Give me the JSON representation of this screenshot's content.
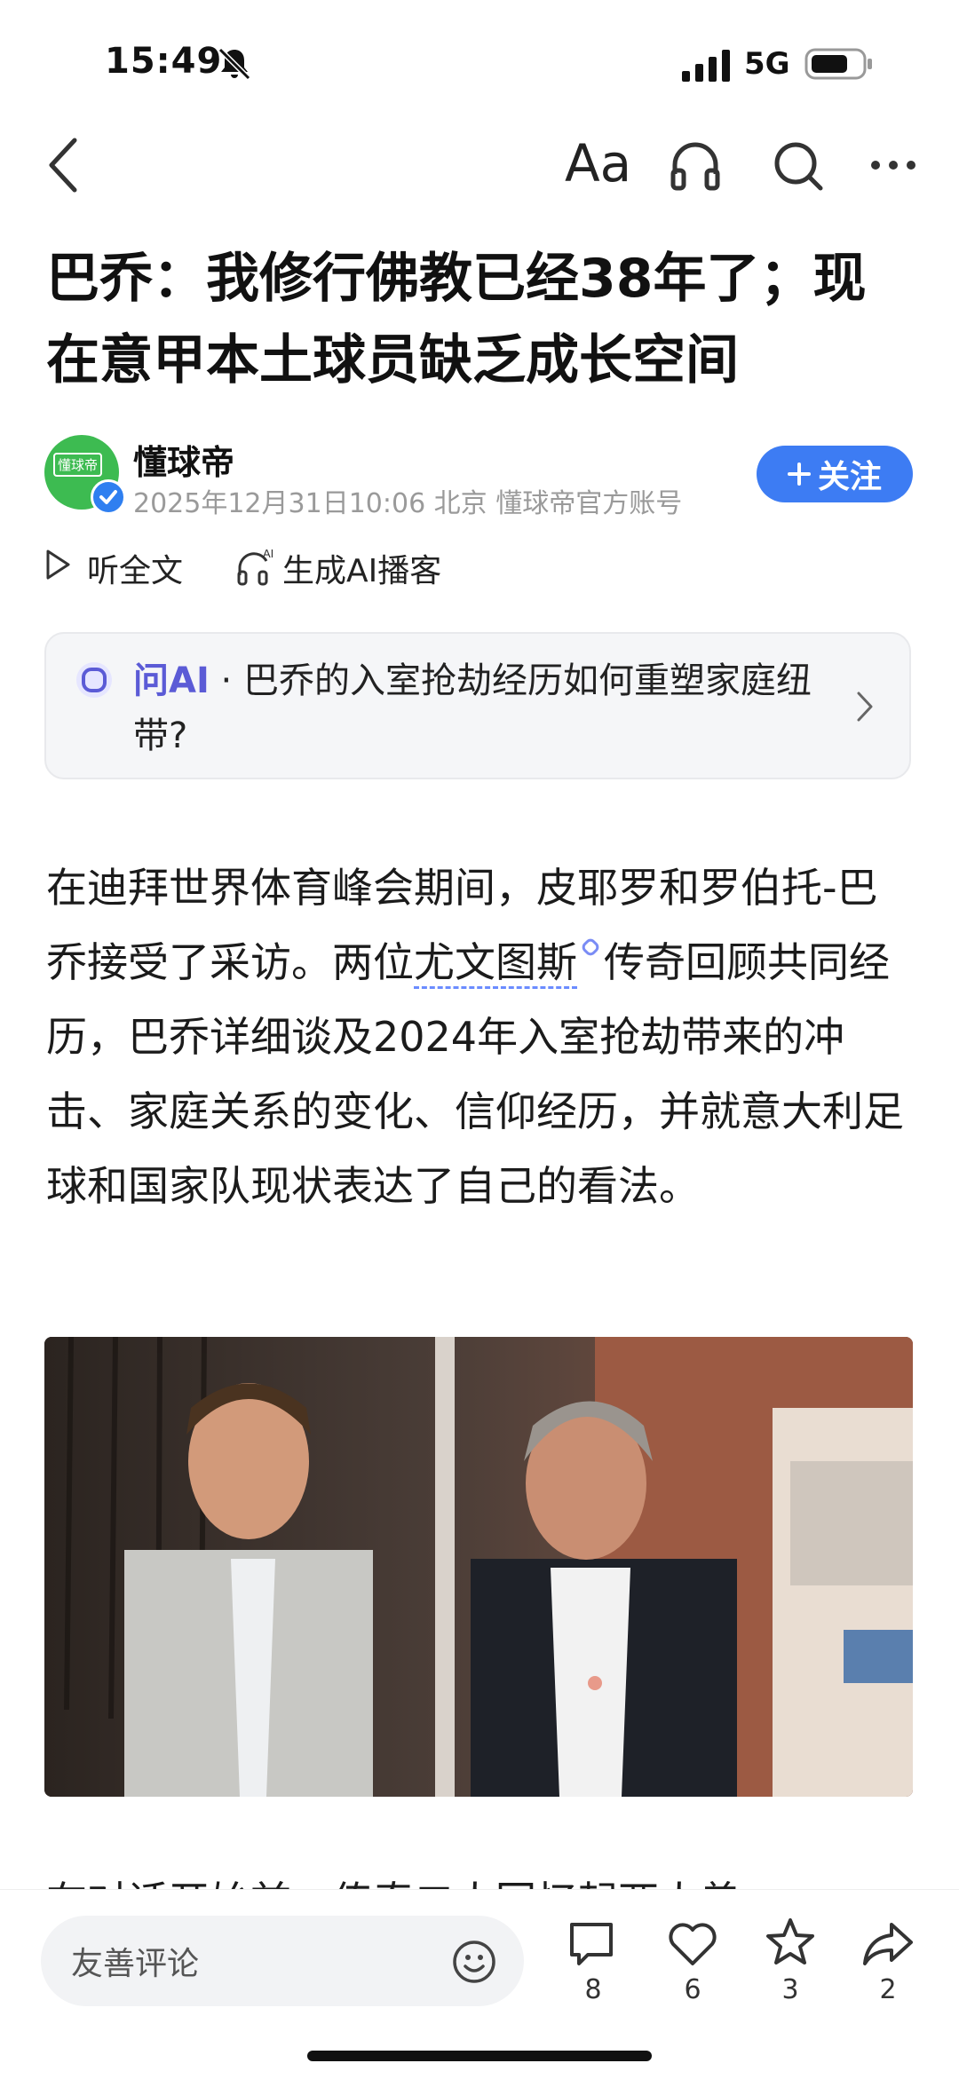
{
  "status_bar": {
    "time": "15:49",
    "network": "5G"
  },
  "article": {
    "title": "巴乔：我修行佛教已经38年了；现在意甲本土球员缺乏成长空间",
    "author": {
      "name": "懂球帝",
      "avatar_text": "懂球帝",
      "meta": "2025年12月31日10:06 北京 懂球帝官方账号",
      "follow_label": "关注"
    },
    "listen_full": "听全文",
    "ai_podcast": "生成AI播客",
    "ask_ai": {
      "label": "问AI",
      "question": "巴乔的入室抢劫经历如何重塑家庭纽带?"
    },
    "paragraph": {
      "part1": "在迪拜世界体育峰会期间，皮耶罗和罗伯托-巴乔接受了采访。两位",
      "entity": "尤文图斯",
      "part2": "传奇回顾共同经历，巴乔详细谈及2024年入室抢劫带来的冲击、家庭关系的变化、信仰经历，并就意大利足球和国家队现状表达了自己的看法。"
    },
    "cutoff_text": "在对话开始前，传奇二人回忆起两人曾"
  },
  "toolbar": {
    "font_label": "Aa"
  },
  "bottom_bar": {
    "comment_placeholder": "友善评论",
    "comment_count": "8",
    "like_count": "6",
    "favorite_count": "3",
    "share_count": "2"
  },
  "colors": {
    "accent": "#3d7cf3",
    "ai": "#5b5bd6",
    "avatar": "#3dbb51"
  }
}
